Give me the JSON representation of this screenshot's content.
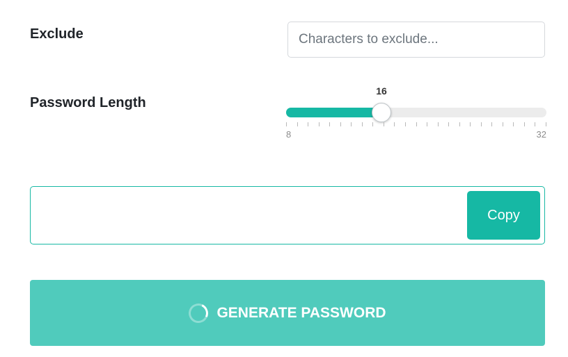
{
  "exclude": {
    "label": "Exclude",
    "value": "",
    "placeholder": "Characters to exclude..."
  },
  "password_length": {
    "label": "Password Length",
    "value": 16,
    "value_label": "16",
    "min": 8,
    "max": 32,
    "min_label": "8",
    "max_label": "32"
  },
  "output": {
    "value": "",
    "copy_label": "Copy"
  },
  "generate": {
    "label": "GENERATE PASSWORD",
    "loading": true
  },
  "colors": {
    "accent": "#16b8a4",
    "button_loading": "#50cbbc"
  }
}
